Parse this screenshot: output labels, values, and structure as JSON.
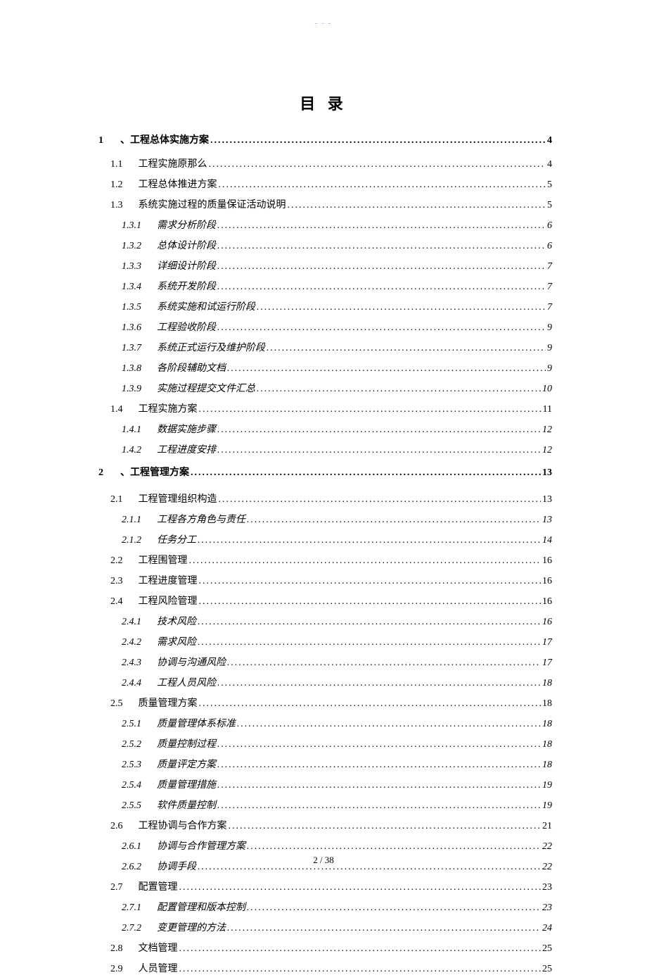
{
  "header_mark": "- - -",
  "title": "目 录",
  "page_footer": "2 / 38",
  "toc": [
    {
      "level": 1,
      "num": "1",
      "label": "、工程总体实施方案",
      "page": "4",
      "cls": "lvl-1"
    },
    {
      "level": 2,
      "num": "1.1",
      "label": "工程实施原那么",
      "page": "4",
      "cls": "lvl-2"
    },
    {
      "level": 2,
      "num": "1.2",
      "label": "工程总体推进方案",
      "page": "5",
      "cls": "lvl-2"
    },
    {
      "level": 2,
      "num": "1.3",
      "label": "系统实施过程的质量保证活动说明",
      "page": "5",
      "cls": "lvl-2"
    },
    {
      "level": 3,
      "num": "1.3.1",
      "label": "需求分析阶段",
      "page": "6",
      "cls": "lvl-3"
    },
    {
      "level": 3,
      "num": "1.3.2",
      "label": "总体设计阶段",
      "page": "6",
      "cls": "lvl-3"
    },
    {
      "level": 3,
      "num": "1.3.3",
      "label": "详细设计阶段",
      "page": "7",
      "cls": "lvl-3"
    },
    {
      "level": 3,
      "num": "1.3.4",
      "label": "系统开发阶段",
      "page": "7",
      "cls": "lvl-3"
    },
    {
      "level": 3,
      "num": "1.3.5",
      "label": "系统实施和试运行阶段",
      "page": "7",
      "cls": "lvl-3"
    },
    {
      "level": 3,
      "num": "1.3.6",
      "label": "工程验收阶段",
      "page": "9",
      "cls": "lvl-3"
    },
    {
      "level": 3,
      "num": "1.3.7",
      "label": "系统正式运行及维护阶段",
      "page": "9",
      "cls": "lvl-3"
    },
    {
      "level": 3,
      "num": "1.3.8",
      "label": "各阶段辅助文档",
      "page": "9",
      "cls": "lvl-3"
    },
    {
      "level": 3,
      "num": "1.3.9",
      "label": "实施过程提交文件汇总",
      "page": "10",
      "cls": "lvl-3"
    },
    {
      "level": 2,
      "num": "1.4",
      "label": "工程实施方案",
      "page": "11",
      "cls": "lvl-2"
    },
    {
      "level": 3,
      "num": "1.4.1",
      "label": "数据实施步骤",
      "page": "12",
      "cls": "lvl-3"
    },
    {
      "level": 3,
      "num": "1.4.2",
      "label": "工程进度安排",
      "page": "12",
      "cls": "lvl-3"
    },
    {
      "level": 1,
      "num": "2",
      "label": "、工程管理方案",
      "page": "13",
      "cls": "lvl-1 section-gap"
    },
    {
      "level": 2,
      "num": "2.1",
      "label": "工程管理组织构造",
      "page": "13",
      "cls": "lvl-2"
    },
    {
      "level": 3,
      "num": "2.1.1",
      "label": "工程各方角色与责任",
      "page": "13",
      "cls": "lvl-3"
    },
    {
      "level": 3,
      "num": "2.1.2",
      "label": "任务分工",
      "page": "14",
      "cls": "lvl-3"
    },
    {
      "level": 2,
      "num": "2.2",
      "label": "工程围管理",
      "page": "16",
      "cls": "lvl-2"
    },
    {
      "level": 2,
      "num": "2.3",
      "label": "工程进度管理",
      "page": "16",
      "cls": "lvl-2"
    },
    {
      "level": 2,
      "num": "2.4",
      "label": "工程风险管理",
      "page": "16",
      "cls": "lvl-2"
    },
    {
      "level": 3,
      "num": "2.4.1",
      "label": "技术风险",
      "page": "16",
      "cls": "lvl-3"
    },
    {
      "level": 3,
      "num": "2.4.2",
      "label": "需求风险",
      "page": "17",
      "cls": "lvl-3"
    },
    {
      "level": 3,
      "num": "2.4.3",
      "label": "协调与沟通风险",
      "page": "17",
      "cls": "lvl-3"
    },
    {
      "level": 3,
      "num": "2.4.4",
      "label": "工程人员风险",
      "page": "18",
      "cls": "lvl-3"
    },
    {
      "level": 2,
      "num": "2.5",
      "label": "质量管理方案",
      "page": "18",
      "cls": "lvl-2"
    },
    {
      "level": 3,
      "num": "2.5.1",
      "label": "质量管理体系标准",
      "page": "18",
      "cls": "lvl-3"
    },
    {
      "level": 3,
      "num": "2.5.2",
      "label": "质量控制过程",
      "page": "18",
      "cls": "lvl-3"
    },
    {
      "level": 3,
      "num": "2.5.3",
      "label": "质量评定方案",
      "page": "18",
      "cls": "lvl-3"
    },
    {
      "level": 3,
      "num": "2.5.4",
      "label": "质量管理措施",
      "page": "19",
      "cls": "lvl-3"
    },
    {
      "level": 3,
      "num": "2.5.5",
      "label": "软件质量控制",
      "page": "19",
      "cls": "lvl-3"
    },
    {
      "level": 2,
      "num": "2.6",
      "label": "工程协调与合作方案",
      "page": "21",
      "cls": "lvl-2"
    },
    {
      "level": 3,
      "num": "2.6.1",
      "label": "协调与合作管理方案",
      "page": "22",
      "cls": "lvl-3"
    },
    {
      "level": 3,
      "num": "2.6.2",
      "label": "协调手段",
      "page": "22",
      "cls": "lvl-3"
    },
    {
      "level": 2,
      "num": "2.7",
      "label": "配置管理",
      "page": "23",
      "cls": "lvl-2"
    },
    {
      "level": 3,
      "num": "2.7.1",
      "label": "配置管理和版本控制",
      "page": "23",
      "cls": "lvl-3"
    },
    {
      "level": 3,
      "num": "2.7.2",
      "label": "变更管理的方法",
      "page": "24",
      "cls": "lvl-3"
    },
    {
      "level": 2,
      "num": "2.8",
      "label": "文档管理",
      "page": "25",
      "cls": "lvl-2"
    },
    {
      "level": 2,
      "num": "2.9",
      "label": "人员管理",
      "page": "25",
      "cls": "lvl-2"
    }
  ]
}
